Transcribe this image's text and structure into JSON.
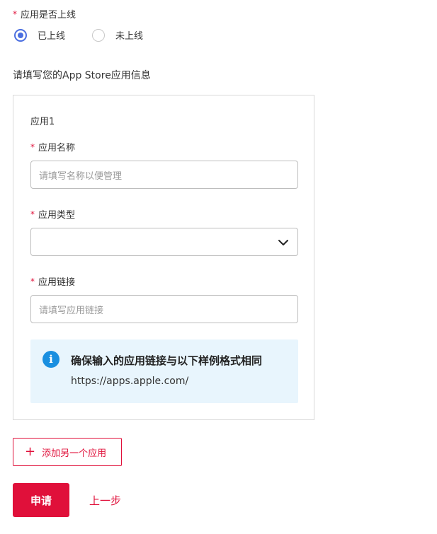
{
  "online_status": {
    "label": "应用是否上线",
    "required_mark": "*",
    "options": [
      {
        "label": "已上线",
        "checked": true
      },
      {
        "label": "未上线",
        "checked": false
      }
    ]
  },
  "section_title": "请填写您的App Store应用信息",
  "app_card": {
    "title": "应用1",
    "name_field": {
      "label": "应用名称",
      "required_mark": "*",
      "placeholder": "请填写名称以便管理"
    },
    "type_field": {
      "label": "应用类型",
      "required_mark": "*",
      "value": "",
      "icon": "chevron-down-icon"
    },
    "link_field": {
      "label": "应用链接",
      "required_mark": "*",
      "placeholder": "请填写应用链接"
    },
    "info_box": {
      "icon": "info-icon",
      "icon_glyph": "i",
      "title": "确保输入的应用链接与以下样例格式相同",
      "example_url": "https://apps.apple.com/"
    }
  },
  "buttons": {
    "add_plus": "+",
    "add_app": "添加另一个应用",
    "submit": "申请",
    "back": "上一步"
  },
  "colors": {
    "accent": "#e0103a",
    "radio_checked": "#4a6ee0",
    "info_bg": "#e8f5fd",
    "info_icon": "#1a8fe0"
  }
}
